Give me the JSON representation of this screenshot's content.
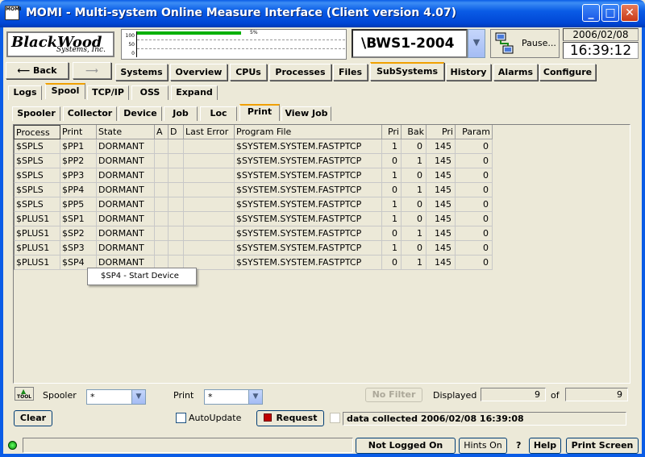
{
  "window": {
    "title": "MOMI - Multi-system Online Measure Interface (Client version 4.07)",
    "icon_text": "MOMI"
  },
  "logo": {
    "name": "BlackWood",
    "sub": "Systems, Inc."
  },
  "graph": {
    "scale": [
      "100",
      "50",
      "0"
    ],
    "pct_label": "5%",
    "cpu_busy": 0.05
  },
  "node": {
    "value": "\\BWS1-2004"
  },
  "pause": {
    "label": "Pause..."
  },
  "clock": {
    "date": "2006/02/08",
    "time": "16:39:12"
  },
  "nav": {
    "back": "Back",
    "items": [
      "Systems",
      "Overview",
      "CPUs",
      "Processes",
      "Files",
      "SubSystems",
      "History",
      "Alarms",
      "Configure"
    ],
    "active": "SubSystems"
  },
  "subsystem_tabs": {
    "items": [
      "Logs",
      "Spool",
      "TCP/IP",
      "OSS",
      "Expand"
    ],
    "active": "Spool"
  },
  "spool_tabs": {
    "items": [
      "Spooler",
      "Collector",
      "Device",
      "Job",
      "Loc",
      "Print",
      "View Job"
    ],
    "active": "Print"
  },
  "table": {
    "columns": [
      "Process",
      "Print",
      "State",
      "A",
      "D",
      "Last Error",
      "Program File",
      "Pri",
      "Bak",
      "Pri",
      "Param"
    ],
    "rows": [
      [
        "$SPLS",
        "$PP1",
        "DORMANT",
        "",
        "",
        "",
        "$SYSTEM.SYSTEM.FASTPTCP",
        "1",
        "0",
        "145",
        "0"
      ],
      [
        "$SPLS",
        "$PP2",
        "DORMANT",
        "",
        "",
        "",
        "$SYSTEM.SYSTEM.FASTPTCP",
        "0",
        "1",
        "145",
        "0"
      ],
      [
        "$SPLS",
        "$PP3",
        "DORMANT",
        "",
        "",
        "",
        "$SYSTEM.SYSTEM.FASTPTCP",
        "1",
        "0",
        "145",
        "0"
      ],
      [
        "$SPLS",
        "$PP4",
        "DORMANT",
        "",
        "",
        "",
        "$SYSTEM.SYSTEM.FASTPTCP",
        "0",
        "1",
        "145",
        "0"
      ],
      [
        "$SPLS",
        "$PP5",
        "DORMANT",
        "",
        "",
        "",
        "$SYSTEM.SYSTEM.FASTPTCP",
        "1",
        "0",
        "145",
        "0"
      ],
      [
        "$PLUS1",
        "$SP1",
        "DORMANT",
        "",
        "",
        "",
        "$SYSTEM.SYSTEM.FASTPTCP",
        "1",
        "0",
        "145",
        "0"
      ],
      [
        "$PLUS1",
        "$SP2",
        "DORMANT",
        "",
        "",
        "",
        "$SYSTEM.SYSTEM.FASTPTCP",
        "0",
        "1",
        "145",
        "0"
      ],
      [
        "$PLUS1",
        "$SP3",
        "DORMANT",
        "",
        "",
        "",
        "$SYSTEM.SYSTEM.FASTPTCP",
        "1",
        "0",
        "145",
        "0"
      ],
      [
        "$PLUS1",
        "$SP4",
        "DORMANT",
        "",
        "",
        "",
        "$SYSTEM.SYSTEM.FASTPTCP",
        "0",
        "1",
        "145",
        "0"
      ]
    ]
  },
  "context_menu": {
    "item": "$SP4 - Start Device"
  },
  "filters": {
    "tool_label": "TOOL",
    "spooler_label": "Spooler",
    "spooler_value": "*",
    "print_label": "Print",
    "print_value": "*",
    "no_filter": "No Filter",
    "displayed_label": "Displayed",
    "displayed_value": "9",
    "of_label": "of",
    "total_value": "9"
  },
  "actions": {
    "clear": "Clear",
    "autoupdate": "AutoUpdate",
    "request": "Request",
    "collected": "data collected 2006/02/08 16:39:08"
  },
  "status": {
    "not_logged_on": "Not Logged On",
    "hints": "Hints On",
    "question": "?",
    "help": "Help",
    "print_screen": "Print Screen"
  },
  "colors": {
    "titlebar": "#0a5ce6",
    "tab_highlight": "#f0a000",
    "led": "#00a000",
    "request_icon": "#c00000"
  }
}
